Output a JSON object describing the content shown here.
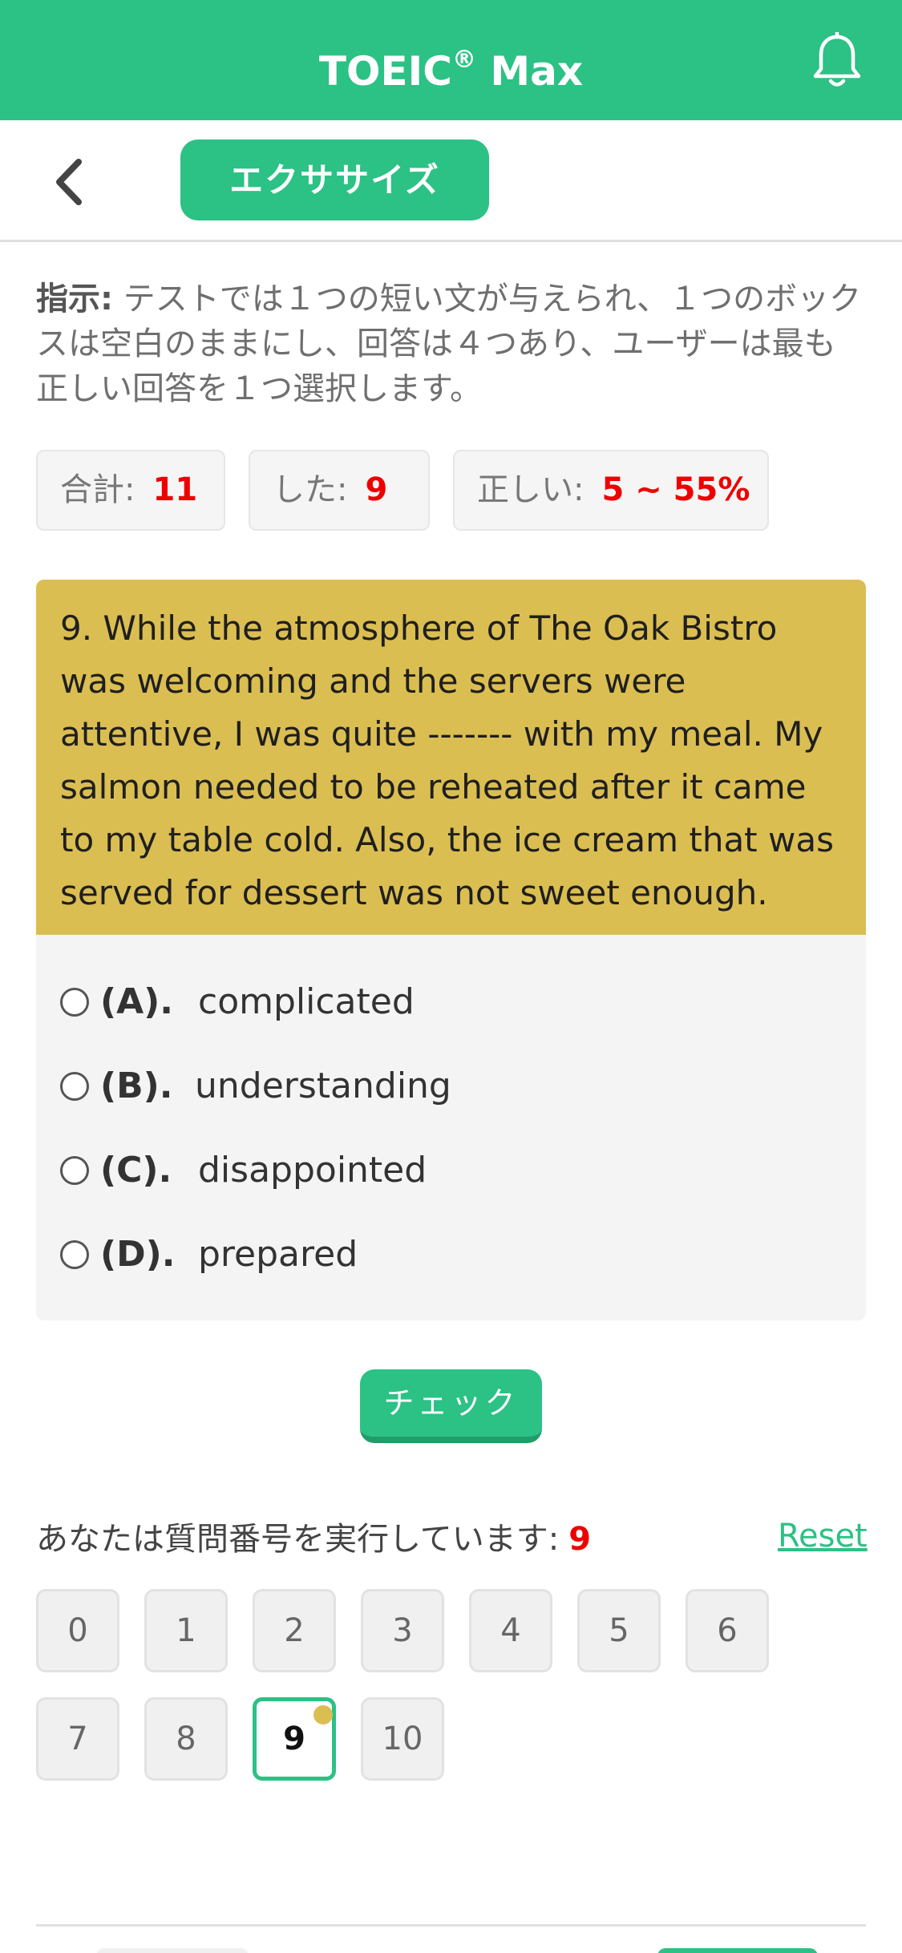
{
  "header": {
    "title": "TOEIC",
    "title_sup": "®",
    "title_suffix": " Max"
  },
  "subheader": {
    "tab_label": "エクササイズ"
  },
  "instruction": {
    "label": "指示:",
    "text": " テストでは１つの短い文が与えられ、１つのボックスは空白のままにし、回答は４つあり、ユーザーは最も正しい回答を１つ選択します。"
  },
  "stats": {
    "total_label": "合計:",
    "total_value": "11",
    "done_label": "した:",
    "done_value": "9",
    "correct_label": "正しい:",
    "correct_value": "5 ~ 55%"
  },
  "question": {
    "text": "9. While the atmosphere of The Oak Bistro was welcoming and the servers were attentive, I was quite ------- with my meal. My salmon needed to be reheated after it came to my table cold. Also, the ice cream that was served for dessert was not sweet enough.",
    "options": [
      {
        "letter": "(A).",
        "text": "complicated"
      },
      {
        "letter": "(B).",
        "text": "understanding"
      },
      {
        "letter": "(C).",
        "text": "disappointed"
      },
      {
        "letter": "(D).",
        "text": "prepared"
      }
    ]
  },
  "check_button": "チェック",
  "progress": {
    "label": "あなたは質問番号を実行しています:",
    "current": "9",
    "reset": "Reset",
    "numbers": [
      "0",
      "1",
      "2",
      "3",
      "4",
      "5",
      "6",
      "7",
      "8",
      "9",
      "10"
    ]
  },
  "colors": {
    "accent": "#2cc185",
    "question_bg": "#dbbe52",
    "highlight_red": "#e00000"
  }
}
